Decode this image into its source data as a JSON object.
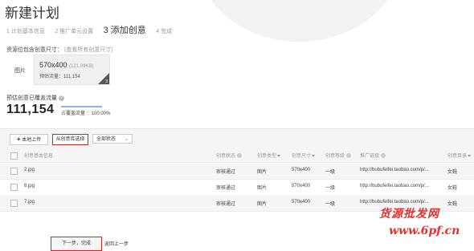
{
  "title": "新建计划",
  "steps": [
    {
      "label": "1 计划基本信息"
    },
    {
      "label": "2 推广单元设置"
    },
    {
      "label": "3 添加创意"
    },
    {
      "label": "4 完成"
    }
  ],
  "size_section": {
    "label": "资源位包含创意尺寸：",
    "note": "(查看所有创意尺寸)",
    "type_label": "图片",
    "size": "570x400",
    "kb": "(121.09KB)",
    "traffic": "预估流量：111,154",
    "corner_num": "3"
  },
  "estimate": {
    "label": "预估创意已覆盖流量",
    "value": "111,154",
    "bar_fraction": 1.0,
    "pct_text": "占覆盖流量 ：100.00%"
  },
  "toolbar": {
    "upload_label": "本地上传",
    "library_label": "从创意库选择",
    "status_label": "全部状态"
  },
  "table": {
    "headers": [
      "创意基本信息",
      "创意状态",
      "创意类型",
      "创意尺寸",
      "创意等级",
      "推广链接",
      "创意目录"
    ],
    "rows": [
      {
        "name": "2.jpg",
        "status": "审核通过",
        "type": "图片",
        "size": "570x400",
        "level": "一级",
        "url": "http://bubufeifei.taobao.com/p/...",
        "dir": "女鞋"
      },
      {
        "name": "8.jpg",
        "status": "审核通过",
        "type": "图片",
        "size": "570x400",
        "level": "一级",
        "url": "http://bubufeifei.taobao.com/p/...",
        "dir": "女鞋"
      },
      {
        "name": "7.jpg",
        "status": "审核通过",
        "type": "图片",
        "size": "570x400",
        "level": "一级",
        "url": "http://bubufeifei.taobao.com/p/...",
        "dir": "女鞋"
      }
    ]
  },
  "footer": {
    "next_label": "下一步，完成",
    "back_label": "返回上一步"
  },
  "watermark": {
    "line1": "货源批发网",
    "line2": "www.6pf.cn"
  },
  "colors": {
    "highlight_border": "#dd2222",
    "watermark": "#e8312c",
    "bar": "#8ab4e8"
  }
}
